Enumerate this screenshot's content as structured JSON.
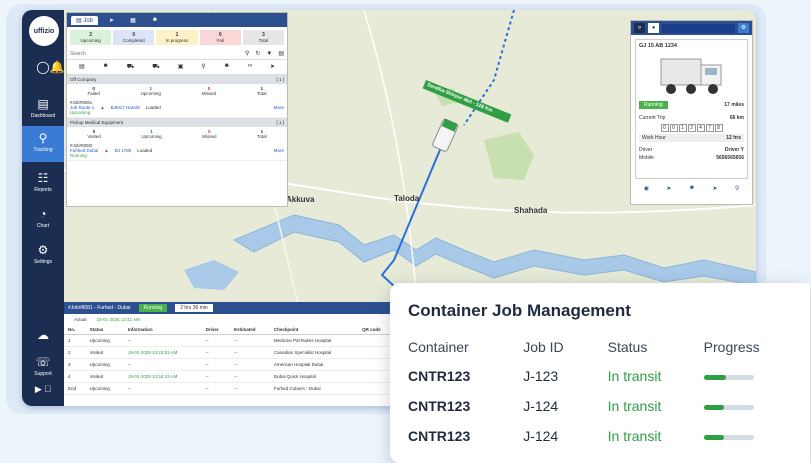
{
  "app": {
    "logo_text": "uffizio",
    "nav": [
      {
        "label": "Dashboard"
      },
      {
        "label": "Tracking"
      },
      {
        "label": "Reports"
      },
      {
        "label": "Chart"
      },
      {
        "label": "Settings"
      }
    ],
    "support_label": "Support"
  },
  "map": {
    "places": [
      "Taloda",
      "Shahada",
      "Akkuva",
      "Na"
    ],
    "route_label": "Sendha-Shirpur 46A - 128 Km"
  },
  "job_panel": {
    "tabs": [
      "Job"
    ],
    "counts": [
      {
        "value": "2",
        "label": "Upcoming",
        "color": "#d9f2d9"
      },
      {
        "value": "0",
        "label": "Completed",
        "color": "#dde4f7"
      },
      {
        "value": "1",
        "label": "In progress",
        "color": "#fcf1c7"
      },
      {
        "value": "0",
        "label": "Fail",
        "color": "#f9d7d7"
      },
      {
        "value": "3",
        "label": "Total",
        "color": "#e6e6e6"
      }
    ],
    "search_placeholder": "Search",
    "groups": [
      {
        "title": "Off Company",
        "count": "[ 1 ]",
        "stats": [
          {
            "v": "0",
            "l": "Failed"
          },
          {
            "v": "1",
            "l": "Upcoming"
          },
          {
            "v": "0",
            "l": "Missed"
          },
          {
            "v": "1",
            "l": "Total"
          }
        ],
        "item": {
          "id": "#Job#8081",
          "name": "Job Route 1",
          "detail": "BJM17 Hamilit",
          "state": "Loaded",
          "status": "Upcoming"
        }
      },
      {
        "title": "Pickup Medical Equipment",
        "count": "[ 1 ]",
        "stats": [
          {
            "v": "0",
            "l": "Visited"
          },
          {
            "v": "1",
            "l": "Upcoming"
          },
          {
            "v": "0",
            "l": "Missed"
          },
          {
            "v": "1",
            "l": "Total"
          }
        ],
        "item": {
          "id": "#Job#8082",
          "name": "Fuhhed Dubai",
          "detail": "BJ 1786",
          "state": "Loaded",
          "status": "Running"
        }
      }
    ],
    "more_label": "More"
  },
  "vehicle": {
    "plate": "GJ 15 AB 1234",
    "status": "Running",
    "distance": "17 miles",
    "current_trip_label": "Current Trip",
    "current_trip_value": "66 km",
    "odometer": [
      "0",
      "0",
      "1",
      "2",
      "4",
      "7",
      "8"
    ],
    "work_hour_label": "Work Hour",
    "work_hour_value": "12 hrs",
    "driver_label": "Driver",
    "driver_value": "Driver Y",
    "mobile_label": "Mobile",
    "mobile_value": "5656565656"
  },
  "bottom": {
    "job_tag": "#Job#8081 - Furhed - Dubai",
    "status": "Running",
    "duration": "2 hrs 36 min",
    "actual_label": "Actual",
    "actual_time": "15-01-2025 13:41 AM",
    "columns": [
      "No.",
      "Status",
      "Information",
      "Driver",
      "Estimated",
      "Checkpoint",
      "QR code"
    ],
    "rows": [
      {
        "no": "1",
        "status": "Upcoming",
        "info": "--",
        "driver": "--",
        "est": "--",
        "cp": "Medicine Pal Rakes Hospital"
      },
      {
        "no": "2",
        "status": "Visited",
        "info": "15-01-2025 13:22:51 AM",
        "driver": "--",
        "est": "--",
        "cp": "Canadian Specialist Hospital"
      },
      {
        "no": "3",
        "status": "Upcoming",
        "info": "--",
        "driver": "--",
        "est": "--",
        "cp": "American Hospital Dubai"
      },
      {
        "no": "4",
        "status": "Visited",
        "info": "15-01-2025 13:54:43 AM",
        "driver": "--",
        "est": "--",
        "cp": "Dubai Quick Hospital"
      },
      {
        "no": "End",
        "status": "Upcoming",
        "info": "--",
        "driver": "--",
        "est": "--",
        "cp": "Furhed Cubiers - Dubai"
      }
    ]
  },
  "container_card": {
    "title": "Container Job Management",
    "columns": [
      "Container",
      "Job ID",
      "Status",
      "Progress"
    ],
    "rows": [
      {
        "container": "CNTR123",
        "job_id": "J-123",
        "status": "In transit",
        "progress": 0.45
      },
      {
        "container": "CNTR123",
        "job_id": "J-124",
        "status": "In transit",
        "progress": 0.4
      },
      {
        "container": "CNTR123",
        "job_id": "J-124",
        "status": "In transit",
        "progress": 0.4
      }
    ]
  },
  "colors": {
    "primary": "#2c4f8f",
    "sidebar": "#1c2d52",
    "success": "#2f9e44",
    "accent_blue": "#3a7bd5"
  }
}
